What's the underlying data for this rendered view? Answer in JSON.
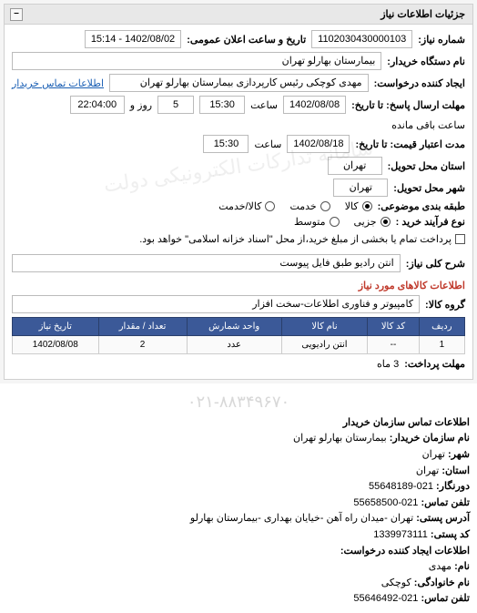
{
  "panel": {
    "title": "جزئیات اطلاعات نیاز"
  },
  "fields": {
    "need_no_label": "شماره نیاز:",
    "need_no": "1102030430000103",
    "announce_label": "تاریخ و ساعت اعلان عمومی:",
    "announce": "1402/08/02 - 15:14",
    "buyer_org_label": "نام دستگاه خریدار:",
    "buyer_org": "بیمارستان بهارلو تهران",
    "requester_label": "ایجاد کننده درخواست:",
    "requester": "مهدی کوچکی  رئیس کارپردازی بیمارستان بهارلو تهران",
    "buyer_contact_link": "اطلاعات تماس خریدار",
    "deadline_to_label": "مهلت ارسال پاسخ: تا تاریخ:",
    "deadline_date": "1402/08/08",
    "saat": "ساعت",
    "deadline_time": "15:30",
    "days_remaining": "5",
    "rooz_va": "روز و",
    "time_remaining": "22:04:00",
    "remaining_label": "ساعت باقی مانده",
    "validity_to_label": "مدت اعتبار قیمت: تا تاریخ:",
    "validity_date": "1402/08/18",
    "validity_time": "15:30",
    "province_label": "استان محل تحویل:",
    "province": "تهران",
    "city_label": "شهر محل تحویل:",
    "city": "تهران",
    "category_label": "طبقه بندی موضوعی:",
    "cat_goods": "کالا",
    "cat_service": "خدمت",
    "cat_both": "کالا/خدمت",
    "purchase_type_label": "نوع فرآیند خرید :",
    "pt_small": "جزیی",
    "pt_medium": "متوسط",
    "settlement_note": "پرداخت تمام یا بخشی از مبلغ خرید،از محل \"اسناد خزانه اسلامی\" خواهد بود.",
    "general_desc_label": "شرح کلی نیاز:",
    "general_desc": "انتن رادیو طبق فایل پیوست",
    "goods_info_title": "اطلاعات کالاهای مورد نیاز",
    "goods_group_label": "گروه کالا:",
    "goods_group": "کامپیوتر و فناوری اطلاعات-سخت افزار"
  },
  "table": {
    "headers": {
      "row": "ردیف",
      "code": "کد کالا",
      "name": "نام کالا",
      "unit": "واحد شمارش",
      "qty": "تعداد / مقدار",
      "date": "تاریخ نیاز"
    },
    "rows": [
      {
        "row": "1",
        "code": "--",
        "name": "انتن رادیویی",
        "unit": "عدد",
        "qty": "2",
        "date": "1402/08/08"
      }
    ]
  },
  "payment_deadline": {
    "label": "مهلت پرداخت:",
    "value": "3 ماه"
  },
  "contact": {
    "title": "اطلاعات تماس سازمان خریدار",
    "org_label": "نام سازمان خریدار:",
    "org": "بیمارستان بهارلو تهران",
    "city_label": "شهر:",
    "city": "تهران",
    "province_label": "استان:",
    "province": "تهران",
    "fax_label": "دورنگار:",
    "fax": "021-55648189",
    "phone_label": "تلفن تماس:",
    "phone": "021-55658500",
    "address_label": "آدرس پستی:",
    "address": "تهران -میدان راه آهن -خیایان بهداری -بیمارستان بهارلو",
    "postal_label": "کد پستی:",
    "postal": "1339973111",
    "requester_title": "اطلاعات ایجاد کننده درخواست:",
    "fname_label": "نام:",
    "fname": "مهدی",
    "lname_label": "نام خانوادگی:",
    "lname": "کوچکی",
    "req_phone_label": "تلفن تماس:",
    "req_phone": "021-55646492",
    "big_phone": "۰۲۱-۸۸۳۴۹۶۷۰"
  }
}
